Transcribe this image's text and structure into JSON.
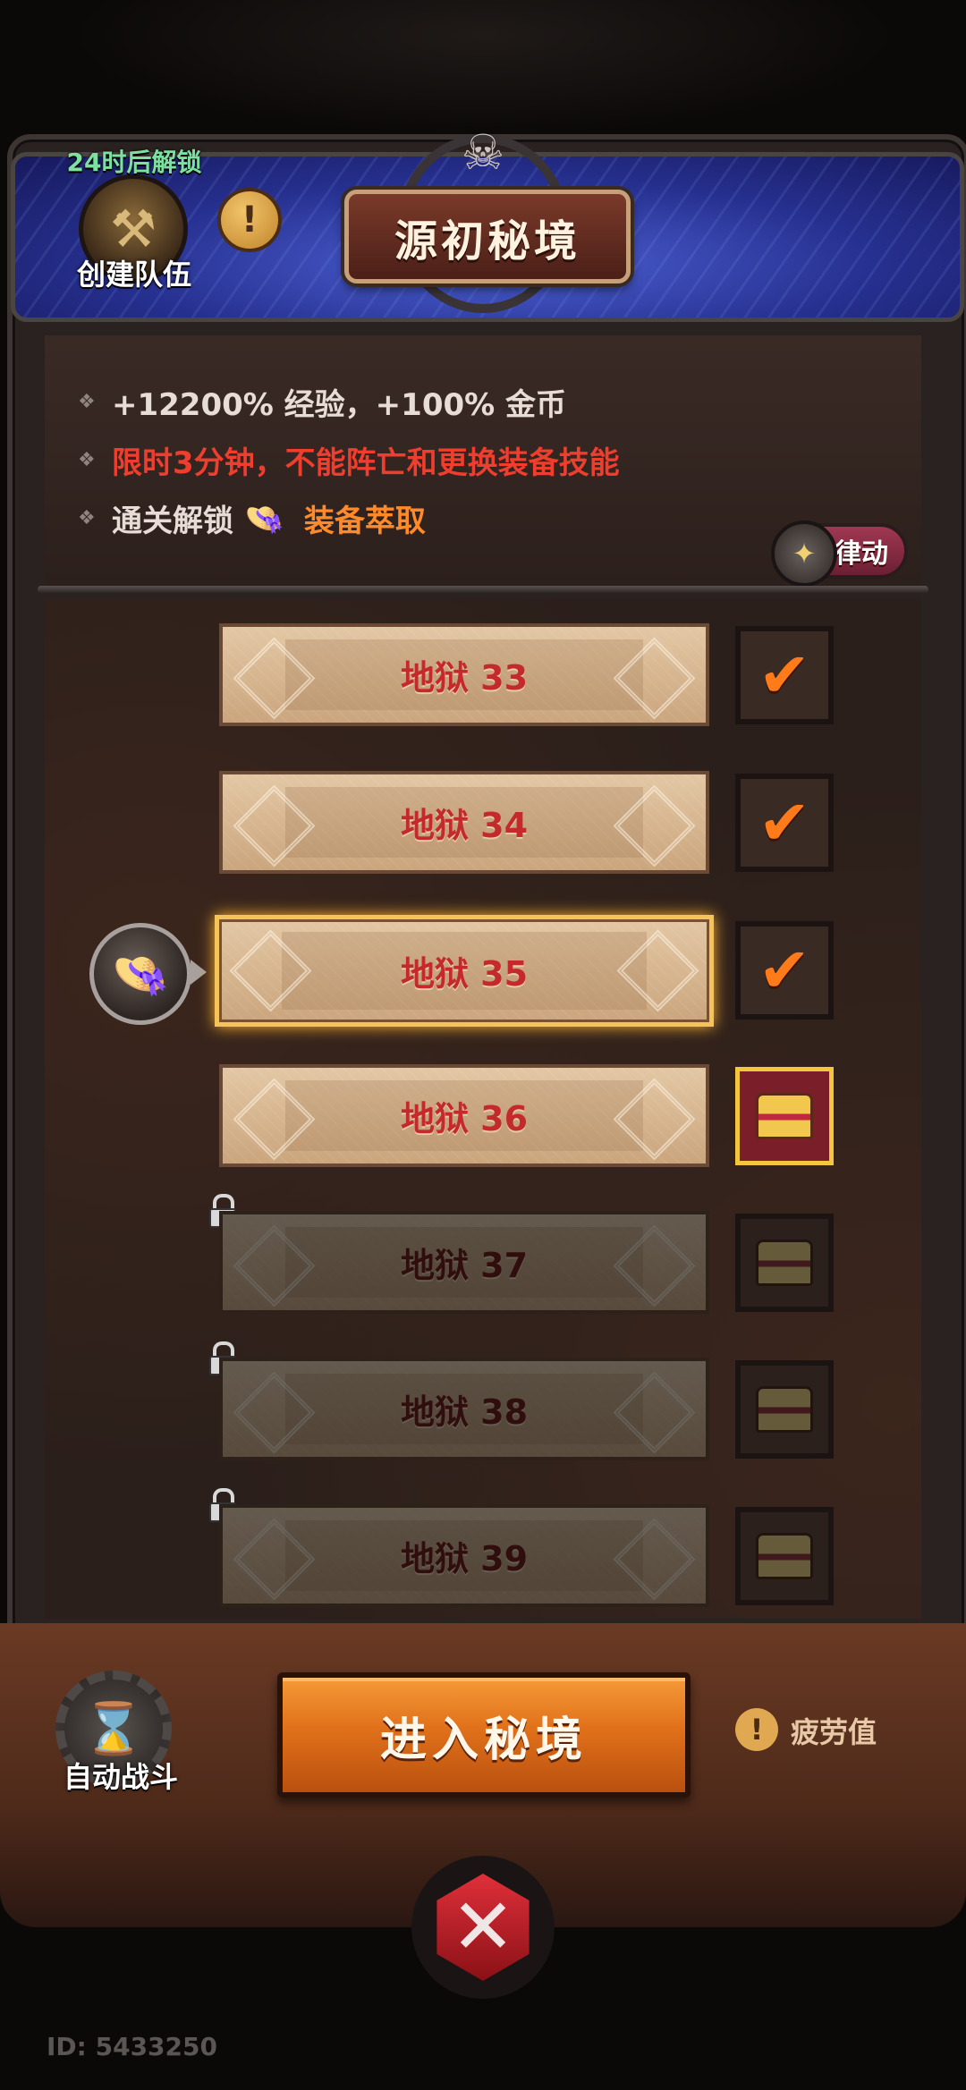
{
  "header": {
    "title": "源初秘境",
    "team_unlock_note": "24时后解锁",
    "team_label": "创建队伍",
    "info_symbol": "!"
  },
  "info": {
    "bonus_text": "+12200% 经验，+100% 金币",
    "limit_text": "限时3分钟，不能阵亡和更换装备技能",
    "unlock_prefix": "通关解锁",
    "unlock_reward": "装备萃取",
    "rhythm_label": "律动"
  },
  "levels": [
    {
      "label": "地狱 33",
      "state": "cleared"
    },
    {
      "label": "地狱 34",
      "state": "cleared"
    },
    {
      "label": "地狱 35",
      "state": "cleared",
      "selected": true
    },
    {
      "label": "地狱 36",
      "state": "reward"
    },
    {
      "label": "地狱 37",
      "state": "locked"
    },
    {
      "label": "地狱 38",
      "state": "locked"
    },
    {
      "label": "地狱 39",
      "state": "locked"
    }
  ],
  "bottom": {
    "enter_label": "进入秘境",
    "auto_label": "自动战斗",
    "fatigue_label": "疲劳值",
    "fatigue_symbol": "!"
  },
  "footer": {
    "user_id": "ID: 5433250"
  },
  "colors": {
    "accent_orange": "#e0701a",
    "danger_red": "#ef3d2e",
    "unlock_green": "#7ee0a0",
    "selected_gold": "#f4c35a"
  }
}
